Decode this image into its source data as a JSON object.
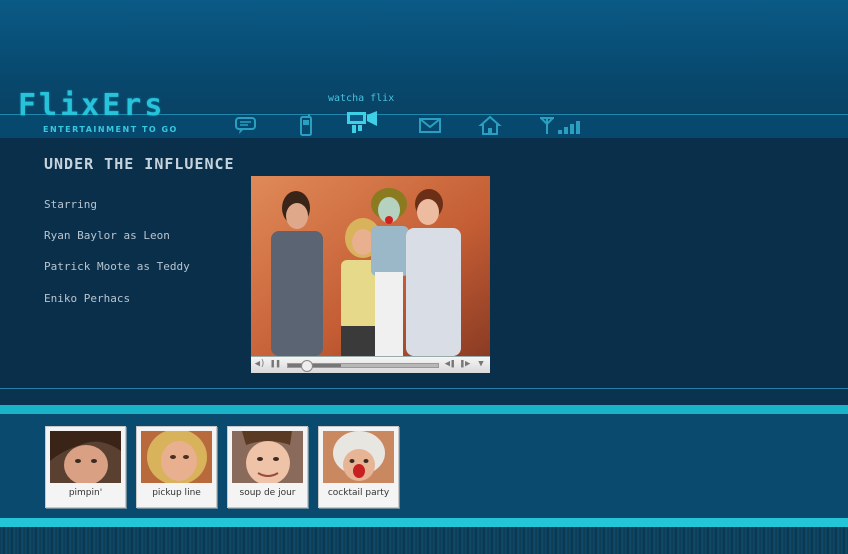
{
  "brand": {
    "logo": "FlixErs",
    "tagline": "ENTERTAINMENT TO GO"
  },
  "nav": {
    "active_label": "watcha flix",
    "items": [
      {
        "icon": "chat-bubble-icon"
      },
      {
        "icon": "cellphone-icon"
      },
      {
        "icon": "video-camera-icon"
      },
      {
        "icon": "envelope-icon"
      },
      {
        "icon": "home-icon"
      },
      {
        "icon": "signal-antenna-icon"
      }
    ]
  },
  "movie": {
    "title": "UNDER THE INFLUENCE",
    "credits": [
      "Starring",
      "Ryan Baylor as Leon",
      "Patrick Moote as Teddy",
      "Eniko Perhacs"
    ]
  },
  "player": {
    "progress": 0.12,
    "buffered": 0.35
  },
  "thumbnails": [
    {
      "label": "pimpin'"
    },
    {
      "label": "pickup line"
    },
    {
      "label": "soup de jour"
    },
    {
      "label": "cocktail party"
    }
  ],
  "colors": {
    "accent": "#18b4c8",
    "background": "#0a2f4b"
  }
}
